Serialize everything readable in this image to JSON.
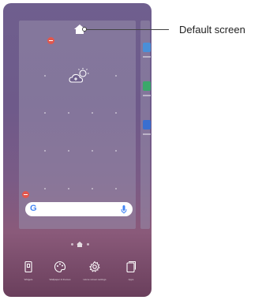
{
  "callout": {
    "text": "Default screen"
  },
  "search": {
    "logo": "G"
  },
  "bottom_menu": [
    {
      "label": "Widgets",
      "icon": "widgets-icon"
    },
    {
      "label": "Wallpaper & themes",
      "icon": "palette-icon"
    },
    {
      "label": "Home screen settings",
      "icon": "gear-icon"
    },
    {
      "label": "Apps",
      "icon": "apps-icon"
    }
  ],
  "colors": {
    "wallpaper_top": "#6f5f8e",
    "wallpaper_bottom": "#6a3f5c",
    "remove_badge": "#e0574e",
    "google_blue": "#4285f4"
  }
}
